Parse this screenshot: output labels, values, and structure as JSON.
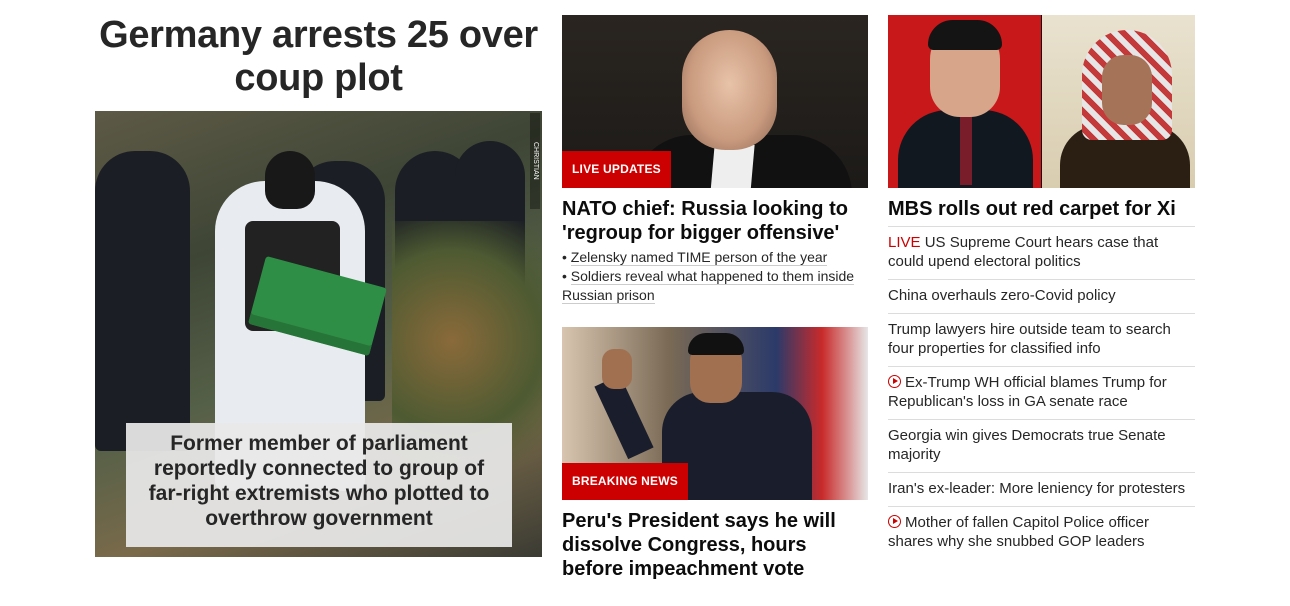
{
  "lead": {
    "headline": "Germany arrests 25 over coup plot",
    "caption": "Former member of parliament reportedly connected to group of far-right extremists who plotted to overthrow government",
    "photo_credit": "CHRISTIAN MANG/REUTERS"
  },
  "column2": {
    "top_story": {
      "badge": "LIVE UPDATES",
      "headline": "NATO chief: Russia looking to 'regroup for bigger offensive'",
      "bullets": [
        "Zelensky named TIME person of the year",
        "Soldiers reveal what happened to them inside Russian prison"
      ]
    },
    "bottom_story": {
      "badge": "BREAKING NEWS",
      "headline": "Peru's President says he will dissolve Congress, hours before impeachment vote"
    }
  },
  "column3": {
    "headline": "MBS rolls out red carpet for Xi",
    "links": [
      {
        "tag": "LIVE",
        "text": "US Supreme Court hears case that could upend electoral politics"
      },
      {
        "text": "China overhauls zero-Covid policy"
      },
      {
        "text": "Trump lawyers hire outside team to search four properties for classified info"
      },
      {
        "icon": "play-video-icon",
        "text": "Ex-Trump WH official blames Trump for Republican's loss in GA senate race"
      },
      {
        "text": "Georgia win gives Democrats true Senate majority"
      },
      {
        "text": "Iran's ex-leader: More leniency for protesters"
      },
      {
        "icon": "play-video-icon",
        "text": "Mother of fallen Capitol Police officer shares why she snubbed GOP leaders"
      }
    ]
  },
  "colors": {
    "accent_red": "#cc0000",
    "text": "#0c0c0c",
    "divider": "#dcdcdc"
  }
}
